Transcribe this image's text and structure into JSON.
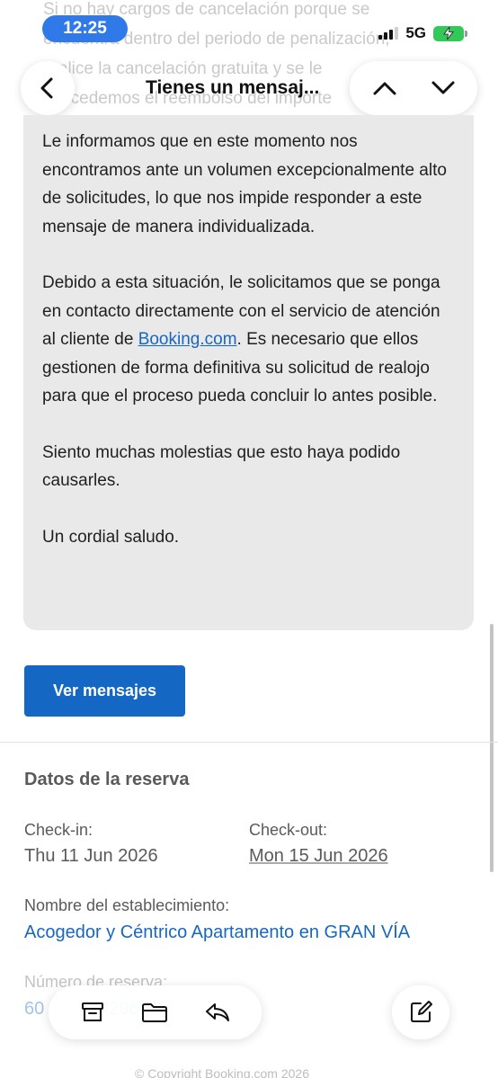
{
  "background_text": {
    "lines": [
      "Si no hay cargos de cancelación porque se",
      "encuentra dentro del periodo de penalización,",
      "realice la cancelación gratuita y se le",
      "concedemos el reembolso del importe"
    ]
  },
  "status_bar": {
    "time": "12:25",
    "network": "5G",
    "battery_color": "#34c759",
    "time_pill_color": "#2f79e8"
  },
  "header": {
    "title": "Tienes un mensaj...",
    "back_icon": "chevron-left-icon",
    "prev_icon": "chevron-up-icon",
    "next_icon": "chevron-down-icon"
  },
  "message": {
    "paragraph_1": "Le informamos que en este momento nos encontramos ante un volumen excepcionalmente alto de solicitudes, lo que nos impide responder a este mensaje de manera individualizada.",
    "paragraph_2_before": "Debido a esta situación, le solicitamos que se ponga en contacto directamente con el servicio de atención al cliente de ",
    "paragraph_2_link": "Booking.com",
    "paragraph_2_after": ". Es necesario que ellos gestionen de forma definitiva su solicitud de realojo para que el proceso pueda concluir lo antes posible.",
    "paragraph_3": "Siento muchas molestias que esto haya podido causarles.",
    "paragraph_4": "Un cordial saludo."
  },
  "actions": {
    "view_messages_label": "Ver mensajes",
    "accent_color": "#1468c4"
  },
  "booking": {
    "section_title": "Datos de la reserva",
    "checkin_label": "Check-in:",
    "checkin_value": "Thu 11 Jun 2026",
    "checkout_label": "Check-out:",
    "checkout_value": "Mon 15 Jun 2026",
    "property_label": "Nombre del establecimiento:",
    "property_value": "Acogedor y Céntrico Apartamento en GRAN VÍA",
    "reservation_label": "Número de reserva:",
    "reservation_value_partial": "60",
    "reservation_value_hidden": "72966"
  },
  "toolbar": {
    "archive_icon": "archive-icon",
    "folder_icon": "folder-icon",
    "reply_icon": "reply-icon",
    "compose_icon": "compose-icon"
  },
  "footer": {
    "text": "© Copyright Booking.com 2026"
  }
}
